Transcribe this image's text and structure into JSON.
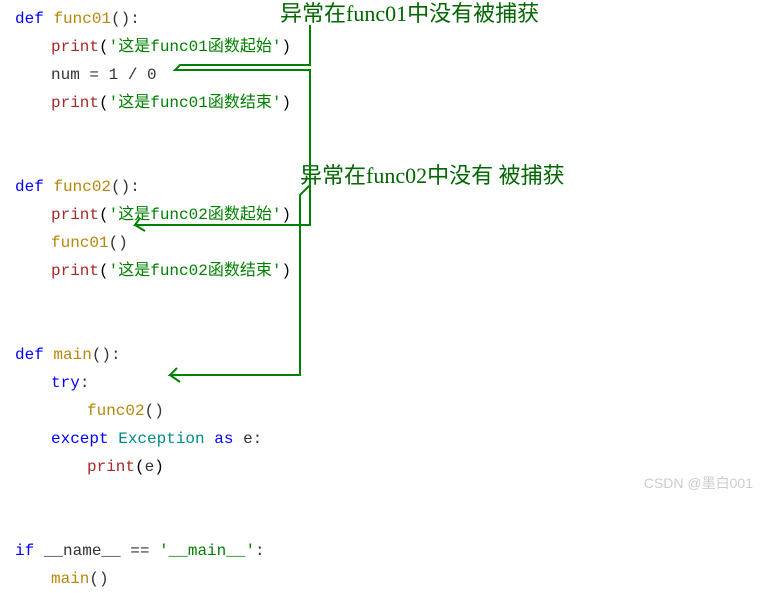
{
  "annotations": {
    "a1": "异常在func01中没有被捕获",
    "a2": "异常在func02中没有  被捕获"
  },
  "code": {
    "l1_def": "def",
    "l1_fn": "func01",
    "l1_paren": "():",
    "l2_print": "print",
    "l2_arg": "'这是func01函数起始'",
    "l3_stmt": "num = 1 / 0",
    "l4_print": "print",
    "l4_arg": "'这是func01函数结束'",
    "l5_def": "def",
    "l5_fn": "func02",
    "l5_paren": "():",
    "l6_print": "print",
    "l6_arg": "'这是func02函数起始'",
    "l7_call": "func01",
    "l7_paren": "()",
    "l8_print": "print",
    "l8_arg": "'这是func02函数结束'",
    "l9_def": "def",
    "l9_fn": "main",
    "l9_paren": "():",
    "l10_try": "try",
    "l10_colon": ":",
    "l11_call": "func02",
    "l11_paren": "()",
    "l12_except": "except",
    "l12_cls": "Exception",
    "l12_as": "as",
    "l12_var": "e",
    "l12_colon": ":",
    "l13_print": "print",
    "l13_arg": "e",
    "l14_if": "if",
    "l14_name": "__name__",
    "l14_eq": " == ",
    "l14_main": "'__main__'",
    "l14_colon": ":",
    "l15_call": "main",
    "l15_paren": "()"
  },
  "watermark": "CSDN @墨白001"
}
